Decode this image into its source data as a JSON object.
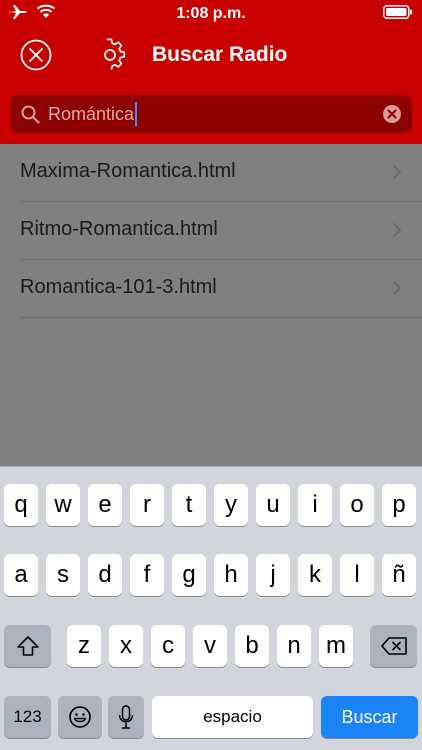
{
  "status_bar": {
    "time": "1:08 p.m."
  },
  "nav": {
    "title": "Buscar Radio"
  },
  "search": {
    "value": "Romántica"
  },
  "results": [
    "Maxima-Romantica.html",
    "Ritmo-Romantica.html",
    "Romantica-101-3.html"
  ],
  "keyboard": {
    "row1": [
      "q",
      "w",
      "e",
      "r",
      "t",
      "y",
      "u",
      "i",
      "o",
      "p"
    ],
    "row2": [
      "a",
      "s",
      "d",
      "f",
      "g",
      "h",
      "j",
      "k",
      "l",
      "ñ"
    ],
    "row3": [
      "z",
      "x",
      "c",
      "v",
      "b",
      "n",
      "m"
    ],
    "numbers_label": "123",
    "space_label": "espacio",
    "go_label": "Buscar"
  },
  "colors": {
    "header": "#c80000",
    "search_field": "#8c0000",
    "overlay": "#808080",
    "keyboard_bg": "#d2d5db",
    "go_key": "#1a83f5"
  }
}
